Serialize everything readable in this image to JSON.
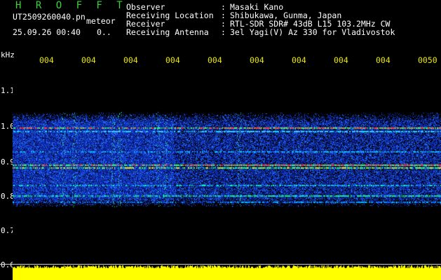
{
  "header": {
    "title": "H R O F F T",
    "filename": "UT2509260040.pn",
    "filename_suffix": "meteor",
    "datetime": "25.09.26 00:40",
    "rate": "0..",
    "info": [
      {
        "label": "Observer",
        "value": "Masaki Kano"
      },
      {
        "label": "Receiving Location",
        "value": "Shibukawa, Gunma, Japan"
      },
      {
        "label": "Receiver",
        "value": "RTL-SDR SDR# 43dB L15 103.2MHz CW"
      },
      {
        "label": "Receiving Antenna",
        "value": "3el Yagi(V) Az 330 for Vladivostok"
      }
    ]
  },
  "axes": {
    "y_unit": "kHz",
    "y_ticks": [
      "1.1",
      "1.0",
      "0.9",
      "0.8",
      "0.7",
      "0.6"
    ],
    "x_ticks": [
      "004",
      "004",
      "004",
      "004",
      "004",
      "004",
      "004",
      "004",
      "004",
      "0050"
    ]
  },
  "colors": {
    "background": "#000000",
    "title": "#3cd23c",
    "tick_labels": "#e8e800",
    "text": "#ffffff",
    "noise_bar": "#ffff00"
  }
}
